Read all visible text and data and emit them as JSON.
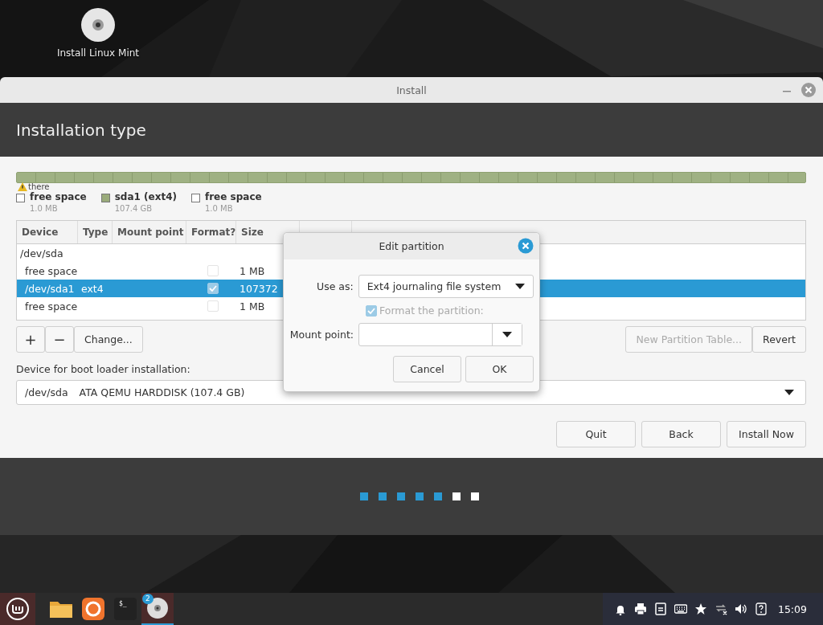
{
  "desktop_icons": [
    {
      "label": "Install Linux Mint"
    }
  ],
  "window": {
    "title": "Install",
    "header": "Installation type"
  },
  "disk_bar": {
    "tooltip": "there",
    "legend": [
      {
        "name": "free space",
        "size": "1.0 MB",
        "color": "#ffffff"
      },
      {
        "name": "sda1 (ext4)",
        "size": "107.4 GB",
        "color": "#9aab7b"
      },
      {
        "name": "free space",
        "size": "1.0 MB",
        "color": "#ffffff"
      }
    ]
  },
  "table": {
    "columns": [
      "Device",
      "Type",
      "Mount point",
      "Format?",
      "Size"
    ],
    "rows": [
      {
        "device": "/dev/sda",
        "selected": false,
        "children": [
          {
            "device": "free space",
            "format": false,
            "size": "1 MB",
            "selected": false
          },
          {
            "device": "/dev/sda1",
            "type": "ext4",
            "format": true,
            "size": "107372",
            "selected": true
          },
          {
            "device": "free space",
            "format": false,
            "size": "1 MB",
            "selected": false
          }
        ]
      }
    ]
  },
  "partition_buttons": [
    {
      "label": "+",
      "kind": "icon"
    },
    {
      "label": "−",
      "kind": "icon"
    },
    {
      "label": "Change...",
      "kind": "text"
    }
  ],
  "right_buttons": [
    {
      "label": "New Partition Table...",
      "disabled": true
    },
    {
      "label": "Revert",
      "disabled": false
    }
  ],
  "boot_loader": {
    "label": "Device for boot loader installation:",
    "device": "/dev/sda",
    "description": "ATA QEMU HARDDISK (107.4 GB)"
  },
  "nav_buttons": [
    "Quit",
    "Back",
    "Install Now"
  ],
  "progress_steps": [
    {
      "done": true
    },
    {
      "done": true
    },
    {
      "done": true
    },
    {
      "done": true
    },
    {
      "done": true
    },
    {
      "done": false
    },
    {
      "done": false
    }
  ],
  "dialog": {
    "title": "Edit partition",
    "use_as_label": "Use as:",
    "use_as_value": "Ext4 journaling file system",
    "format_label": "Format the partition:",
    "format_checked": true,
    "format_disabled": true,
    "mount_label": "Mount point:",
    "buttons": [
      "Cancel",
      "OK"
    ]
  },
  "taskbar": {
    "apps": [
      {
        "kind": "menu"
      },
      {
        "kind": "folder"
      },
      {
        "kind": "firefox"
      },
      {
        "kind": "terminal",
        "label": "$_"
      },
      {
        "kind": "disc",
        "badge": "2",
        "active": true
      }
    ],
    "tray": [
      {
        "kind": "bell"
      },
      {
        "kind": "printer"
      },
      {
        "kind": "notes"
      },
      {
        "kind": "keyboard"
      },
      {
        "kind": "star"
      },
      {
        "kind": "network"
      },
      {
        "kind": "volume"
      },
      {
        "kind": "help"
      }
    ],
    "clock": "15:09"
  }
}
